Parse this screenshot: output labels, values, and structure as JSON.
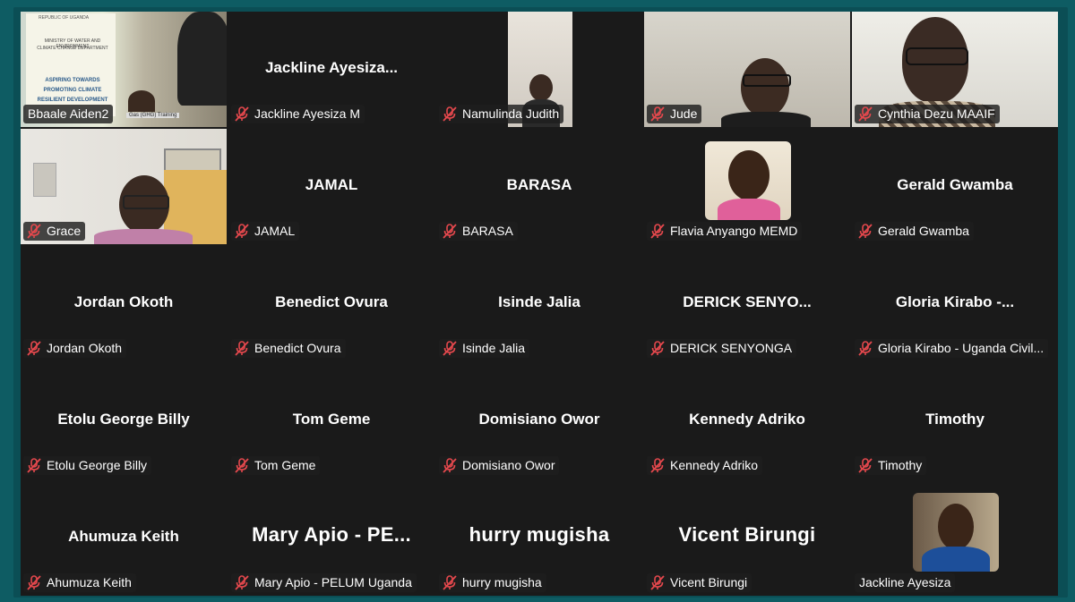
{
  "meeting": {
    "tiles": [
      {
        "id": "t1",
        "display": "",
        "label": "Bbaale Aiden2",
        "muted": false,
        "video": "slide",
        "active": true
      },
      {
        "id": "t2",
        "display": "Jackline  Ayesiza...",
        "label": "Jackline Ayesiza M",
        "muted": true,
        "video": "none"
      },
      {
        "id": "t3",
        "display": "",
        "label": "Namulinda Judith",
        "muted": true,
        "video": "room"
      },
      {
        "id": "t4",
        "display": "",
        "label": "Jude",
        "muted": true,
        "video": "man"
      },
      {
        "id": "t5",
        "display": "",
        "label": "Cynthia Dezu MAAIF",
        "muted": true,
        "video": "woman"
      },
      {
        "id": "t6",
        "display": "",
        "label": "Grace",
        "muted": true,
        "video": "grace"
      },
      {
        "id": "t7",
        "display": "JAMAL",
        "label": "JAMAL",
        "muted": true,
        "video": "none"
      },
      {
        "id": "t8",
        "display": "BARASA",
        "label": "BARASA",
        "muted": true,
        "video": "none"
      },
      {
        "id": "t9",
        "display": "",
        "label": "Flavia Anyango MEMD",
        "muted": true,
        "video": "avatar"
      },
      {
        "id": "t10",
        "display": "Gerald Gwamba",
        "label": "Gerald Gwamba",
        "muted": true,
        "video": "none"
      },
      {
        "id": "t11",
        "display": "Jordan Okoth",
        "label": "Jordan Okoth",
        "muted": true,
        "video": "none"
      },
      {
        "id": "t12",
        "display": "Benedict Ovura",
        "label": "Benedict Ovura",
        "muted": true,
        "video": "none"
      },
      {
        "id": "t13",
        "display": "Isinde Jalia",
        "label": "Isinde Jalia",
        "muted": true,
        "video": "none"
      },
      {
        "id": "t14",
        "display": "DERICK  SENYO...",
        "label": "DERICK SENYONGA",
        "muted": true,
        "video": "none"
      },
      {
        "id": "t15",
        "display": "Gloria  Kirabo  -...",
        "label": "Gloria Kirabo - Uganda Civil...",
        "muted": true,
        "video": "none"
      },
      {
        "id": "t16",
        "display": "Etolu George Billy",
        "label": "Etolu George Billy",
        "muted": true,
        "video": "none"
      },
      {
        "id": "t17",
        "display": "Tom Geme",
        "label": "Tom Geme",
        "muted": true,
        "video": "none"
      },
      {
        "id": "t18",
        "display": "Domisiano Owor",
        "label": "Domisiano Owor",
        "muted": true,
        "video": "none"
      },
      {
        "id": "t19",
        "display": "Kennedy Adriko",
        "label": "Kennedy Adriko",
        "muted": true,
        "video": "none"
      },
      {
        "id": "t20",
        "display": "Timothy",
        "label": "Timothy",
        "muted": true,
        "video": "none"
      },
      {
        "id": "t21",
        "display": "Ahumuza Keith",
        "label": "Ahumuza Keith",
        "muted": true,
        "video": "none"
      },
      {
        "id": "t22",
        "display": "Mary Apio  -  PE...",
        "label": "Mary Apio - PELUM Uganda",
        "muted": true,
        "video": "none",
        "xl": true
      },
      {
        "id": "t23",
        "display": "hurry mugisha",
        "label": "hurry mugisha",
        "muted": true,
        "video": "none",
        "xl": true
      },
      {
        "id": "t24",
        "display": "Vicent Birungi",
        "label": "Vicent Birungi",
        "muted": true,
        "video": "none",
        "xl": true
      },
      {
        "id": "t25",
        "display": "",
        "label": "Jackline Ayesiza",
        "muted": false,
        "video": "avatar2"
      }
    ],
    "slide_text": {
      "header": "REPUBLIC OF UGANDA",
      "ministry": "MINISTRY OF WATER AND ENVIRONMENT",
      "dept": "CLIMATE CHANGE DEPARTMENT",
      "line1": "ASPIRING TOWARDS",
      "line2": "PROMOTING CLIMATE",
      "line3": "RESILIENT DEVELOPMENT",
      "footer": "Gas (GHG) Training"
    },
    "colors": {
      "background": "#0e5c63",
      "tile": "#1a1a1a",
      "active_border": "#4ce08a",
      "mute_icon": "#e5484d"
    },
    "mute_icon_name": "microphone-muted-icon"
  }
}
